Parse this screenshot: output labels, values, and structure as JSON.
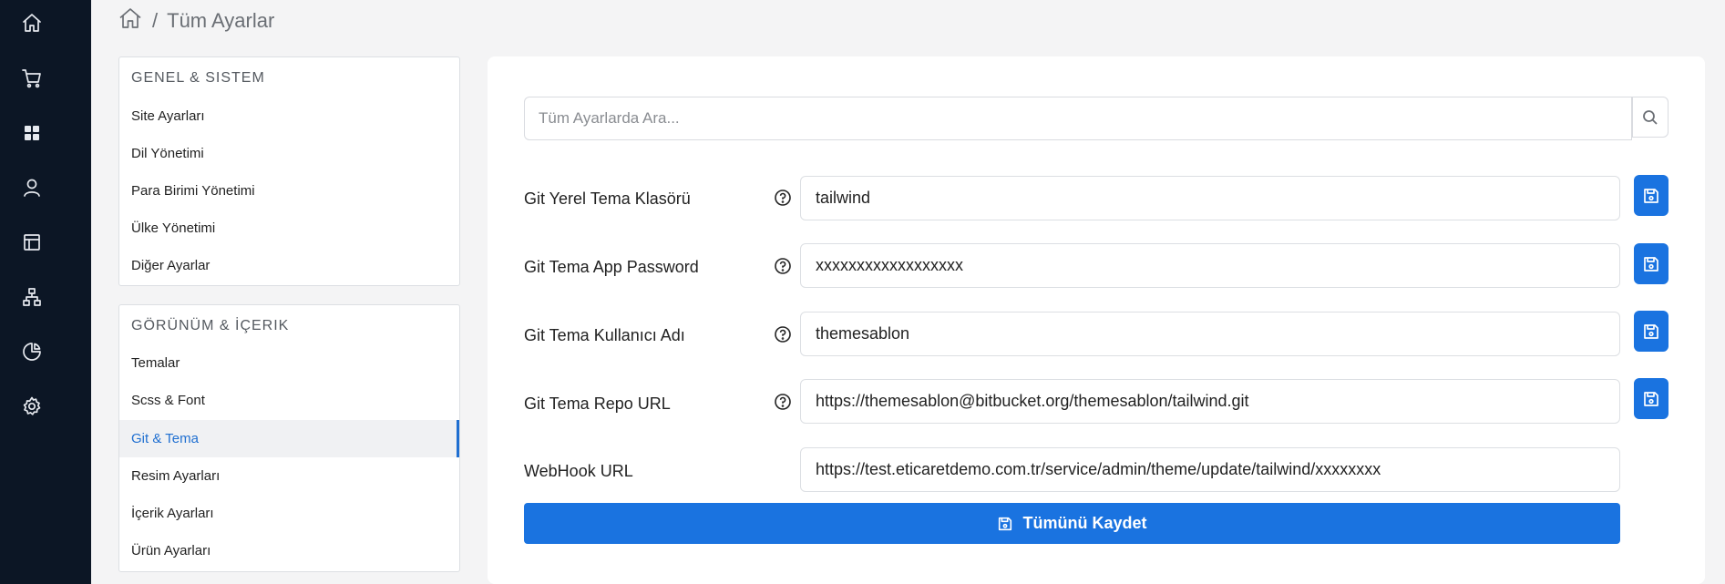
{
  "breadcrumb": {
    "home_icon": "home-icon",
    "separator": "/",
    "current": "Tüm Ayarlar"
  },
  "rail": {
    "icons": [
      "home-icon",
      "cart-icon",
      "grid-icon",
      "user-icon",
      "layout-icon",
      "sitemap-icon",
      "pie-chart-icon",
      "gear-icon"
    ]
  },
  "menu": {
    "sections": [
      {
        "title": "GENEL & SISTEM",
        "items": [
          "Site Ayarları",
          "Dil Yönetimi",
          "Para Birimi Yönetimi",
          "Ülke Yönetimi",
          "Diğer Ayarlar"
        ]
      },
      {
        "title": "GÖRÜNÜM & İÇERIK",
        "items": [
          "Temalar",
          "Scss & Font",
          "Git & Tema",
          "Resim Ayarları",
          "İçerik Ayarları",
          "Ürün Ayarları"
        ]
      }
    ],
    "active": "Git & Tema"
  },
  "search": {
    "placeholder": "Tüm Ayarlarda Ara...",
    "icon": "search-icon"
  },
  "settings": [
    {
      "label": "Git Yerel Tema Klasörü",
      "value": "tailwind"
    },
    {
      "label": "Git Tema App Password",
      "value": "xxxxxxxxxxxxxxxxxx"
    },
    {
      "label": "Git Tema Kullanıcı Adı",
      "value": "themesablon"
    },
    {
      "label": "Git Tema Repo URL",
      "value": "https://themesablon@bitbucket.org/themesablon/tailwind.git"
    },
    {
      "label": "WebHook URL",
      "value": "https://test.eticaretdemo.com.tr/service/admin/theme/update/tailwind/xxxxxxxx"
    }
  ],
  "save_all_label": "Tümünü Kaydet",
  "colors": {
    "accent": "#1a73e0",
    "rail": "#0c1625",
    "active_text": "#1f6fd1"
  }
}
